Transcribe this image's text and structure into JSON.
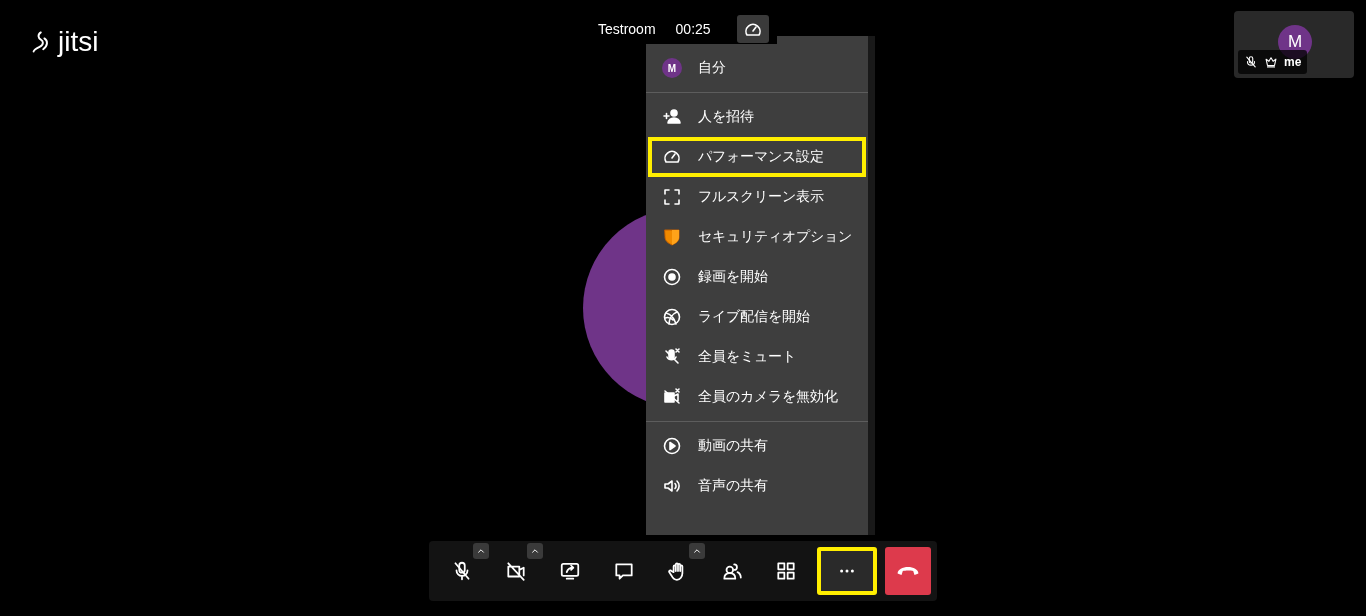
{
  "logo": {
    "text": "jitsi"
  },
  "header": {
    "room_name": "Testroom",
    "timer": "00:25"
  },
  "thumbnail": {
    "initial": "M",
    "name": "me"
  },
  "menu": {
    "sections": [
      {
        "items": [
          {
            "kind": "avatar",
            "initial": "M",
            "label": "自分",
            "highlighted": false
          }
        ]
      },
      {
        "items": [
          {
            "kind": "action",
            "label": "人を招待",
            "highlighted": false
          },
          {
            "kind": "action",
            "label": "パフォーマンス設定",
            "highlighted": true
          },
          {
            "kind": "action",
            "label": "フルスクリーン表示",
            "highlighted": false
          },
          {
            "kind": "action",
            "label": "セキュリティオプション",
            "highlighted": false
          },
          {
            "kind": "action",
            "label": "録画を開始",
            "highlighted": false
          },
          {
            "kind": "action",
            "label": "ライブ配信を開始",
            "highlighted": false
          },
          {
            "kind": "action",
            "label": "全員をミュート",
            "highlighted": false
          },
          {
            "kind": "action",
            "label": "全員のカメラを無効化",
            "highlighted": false
          }
        ]
      },
      {
        "items": [
          {
            "kind": "action",
            "label": "動画の共有",
            "highlighted": false
          },
          {
            "kind": "action",
            "label": "音声の共有",
            "highlighted": false
          }
        ]
      }
    ]
  },
  "toolbar": {
    "buttons": [
      {
        "kind": "normal",
        "has_options": true,
        "selected": false,
        "highlighted": false
      },
      {
        "kind": "normal",
        "has_options": true,
        "selected": false,
        "highlighted": false
      },
      {
        "kind": "normal",
        "has_options": false,
        "selected": false,
        "highlighted": false
      },
      {
        "kind": "normal",
        "has_options": false,
        "selected": false,
        "highlighted": false
      },
      {
        "kind": "normal",
        "has_options": true,
        "selected": false,
        "highlighted": false
      },
      {
        "kind": "normal",
        "has_options": false,
        "selected": false,
        "highlighted": false
      },
      {
        "kind": "normal",
        "has_options": false,
        "selected": false,
        "highlighted": false
      },
      {
        "kind": "normal",
        "has_options": false,
        "selected": true,
        "highlighted": true
      },
      {
        "kind": "hangup",
        "has_options": false,
        "selected": false,
        "highlighted": false
      }
    ]
  }
}
